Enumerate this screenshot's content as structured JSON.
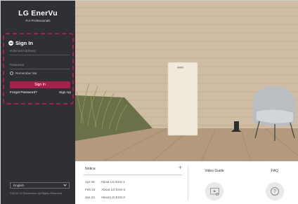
{
  "brand": {
    "title": "LG EnerVu",
    "subtitle": "For Professionals"
  },
  "login": {
    "title": "Sign In",
    "id_placeholder": "ID(Email Address)",
    "password_placeholder": "Password",
    "remember_label": "Remember Me",
    "signin_button": "Sign In",
    "forgot_link": "Forgot Password?",
    "signup_link": "Sign Up"
  },
  "footer": {
    "language": "English",
    "copyright": "©2018 LG Electronics. All Rights Reserved."
  },
  "notice": {
    "title": "Notice",
    "items": [
      {
        "date": "Apr 06",
        "title": "About LG ESS-1"
      },
      {
        "date": "Feb 23",
        "title": "About LG ESS-2"
      },
      {
        "date": "Jan 24",
        "title": "About LG ESS-3"
      }
    ]
  },
  "video_guide": {
    "label": "Video Guide"
  },
  "faq": {
    "label": "FAQ",
    "symbol": "?"
  },
  "colors": {
    "sidebar_bg": "#2f3035",
    "accent": "#a8204a",
    "wall": "#cdb99e",
    "deck": "#b49a7c"
  },
  "icons": {
    "signin": "signin-icon",
    "plus": "plus-icon",
    "chevron": "chevron-down-icon",
    "video": "video-guide-icon",
    "faq": "question-icon"
  }
}
